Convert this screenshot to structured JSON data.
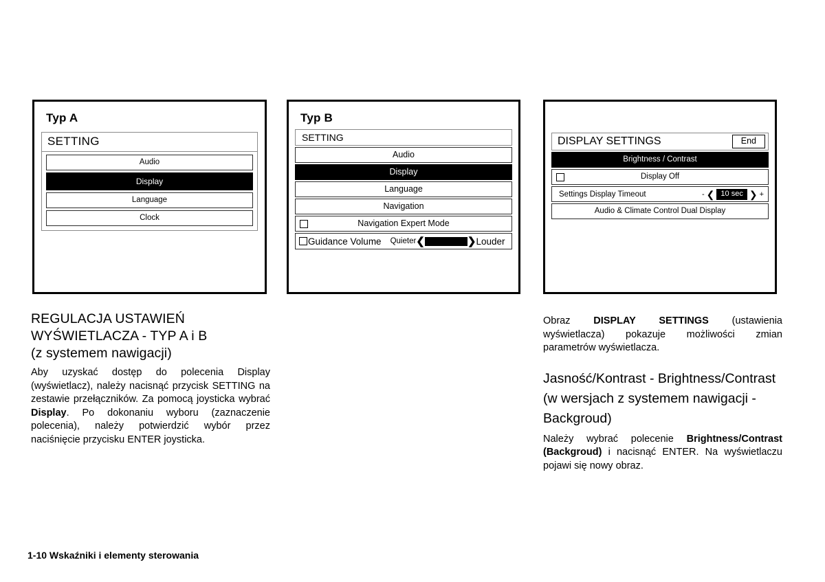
{
  "figures": {
    "typ_a": {
      "title": "Typ A",
      "screen_header": "SETTING",
      "items": [
        {
          "label": "Audio",
          "selected": false
        },
        {
          "label": "Display",
          "selected": true
        },
        {
          "label": "Language",
          "selected": false
        },
        {
          "label": "Clock",
          "selected": false
        }
      ]
    },
    "typ_b": {
      "title": "Typ B",
      "screen_header": "SETTING",
      "items": [
        {
          "label": "Audio",
          "selected": false
        },
        {
          "label": "Display",
          "selected": true
        },
        {
          "label": "Language",
          "selected": false
        },
        {
          "label": "Navigation",
          "selected": false
        }
      ],
      "checkbox_row": {
        "label": "Navigation Expert Mode",
        "checked": false
      },
      "volume_row": {
        "label": "Guidance Volume",
        "checked": false,
        "min_label": "Quieter",
        "max_label": "Louder",
        "left_arrow": "❮",
        "right_arrow": "❯"
      }
    },
    "display_settings": {
      "header": "DISPLAY SETTINGS",
      "end_button": "End",
      "rows": [
        {
          "label": "Brightness / Contrast",
          "selected": true,
          "type": "plain"
        },
        {
          "label": "Display Off",
          "selected": false,
          "type": "checkbox",
          "checked": false
        },
        {
          "label": "Audio & Climate Control Dual Display",
          "selected": false,
          "type": "plain"
        }
      ],
      "timeout": {
        "label": "Settings Display Timeout",
        "minus": "-",
        "plus": "+",
        "left_arrow": "❮",
        "right_arrow": "❯",
        "value": "10 sec"
      }
    }
  },
  "left_column": {
    "heading_line1": "REGULACJA USTAWIEŃ",
    "heading_line2": "WYŚWIETLACZA  - TYP A i B",
    "heading_line3": "(z systemem nawigacji)",
    "paragraph_1_part1": "Aby uzyskać dostęp do polecenia Display (wyświetlacz), należy nacisnąć przycisk SETTING na zestawie przełączników. Za pomocą joysticka wybrać ",
    "paragraph_1_bold": "Display",
    "paragraph_1_part2": ". Po dokonaniu wyboru (zaznaczenie polecenia), należy potwierdzić wybór przez naciśnięcie przycisku ENTER joysticka."
  },
  "right_column": {
    "paragraph_1_part1": "Obraz ",
    "paragraph_1_bold": "DISPLAY SETTINGS",
    "paragraph_1_part2": " (ustawienia wyświetlacza) pokazuje możliwości zmian parametrów wyświetlacza.",
    "heading": "Jasność/Kontrast - Brightness/Contrast (w wersjach z systemem nawigacji - Backgroud)",
    "paragraph_2_part1": "Należy wybrać polecenie ",
    "paragraph_2_bold": "Brightness/Contrast (Backgroud)",
    "paragraph_2_part2": " i nacisnąć ENTER. Na wyświetlaczu pojawi się nowy obraz."
  },
  "footer": {
    "text": "1-10 Wskaźniki i elementy sterowania"
  }
}
